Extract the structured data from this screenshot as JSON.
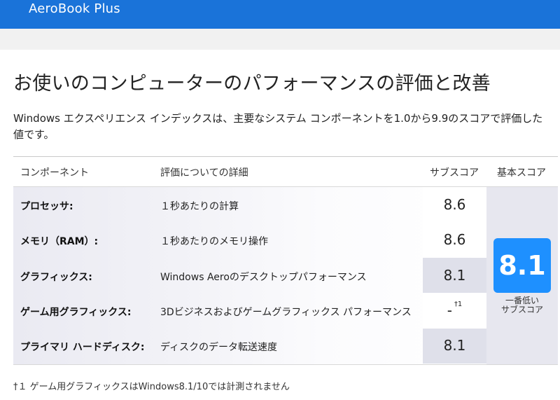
{
  "app": {
    "title": "AeroBook Plus"
  },
  "page": {
    "title": "お使いのコンピューターのパフォーマンスの評価と改善",
    "description": "Windows エクスペリエンス インデックスは、主要なシステム コンポーネントを1.0から9.9のスコアで評価した値です。"
  },
  "table": {
    "headers": {
      "component": "コンポーネント",
      "detail": "評価についての詳細",
      "subscore": "サブスコア",
      "basescore": "基本スコア"
    },
    "rows": [
      {
        "label": "プロセッサ:",
        "detail": "１秒あたりの計算",
        "score": "8.6",
        "note": ""
      },
      {
        "label": "メモリ（RAM）:",
        "detail": "１秒あたりのメモリ操作",
        "score": "8.6",
        "note": ""
      },
      {
        "label": "グラフィックス:",
        "detail": "Windows Aeroのデスクトップパフォーマンス",
        "score": "8.1",
        "note": ""
      },
      {
        "label": "ゲーム用グラフィックス:",
        "detail": "3Dビジネスおよびゲームグラフィックス パフォーマンス",
        "score": "-",
        "note": "†1"
      },
      {
        "label": "プライマリ ハードディスク:",
        "detail": "ディスクのデータ転送速度",
        "score": "8.1",
        "note": ""
      }
    ],
    "base_score": "8.1",
    "base_caption_line1": "一番低い",
    "base_caption_line2": "サブスコア"
  },
  "footnote": "†１ ゲーム用グラフィックスはWindows8.1/10では計測されません",
  "colors": {
    "topbar": "#1a73d9",
    "badge": "#1e90ff"
  }
}
